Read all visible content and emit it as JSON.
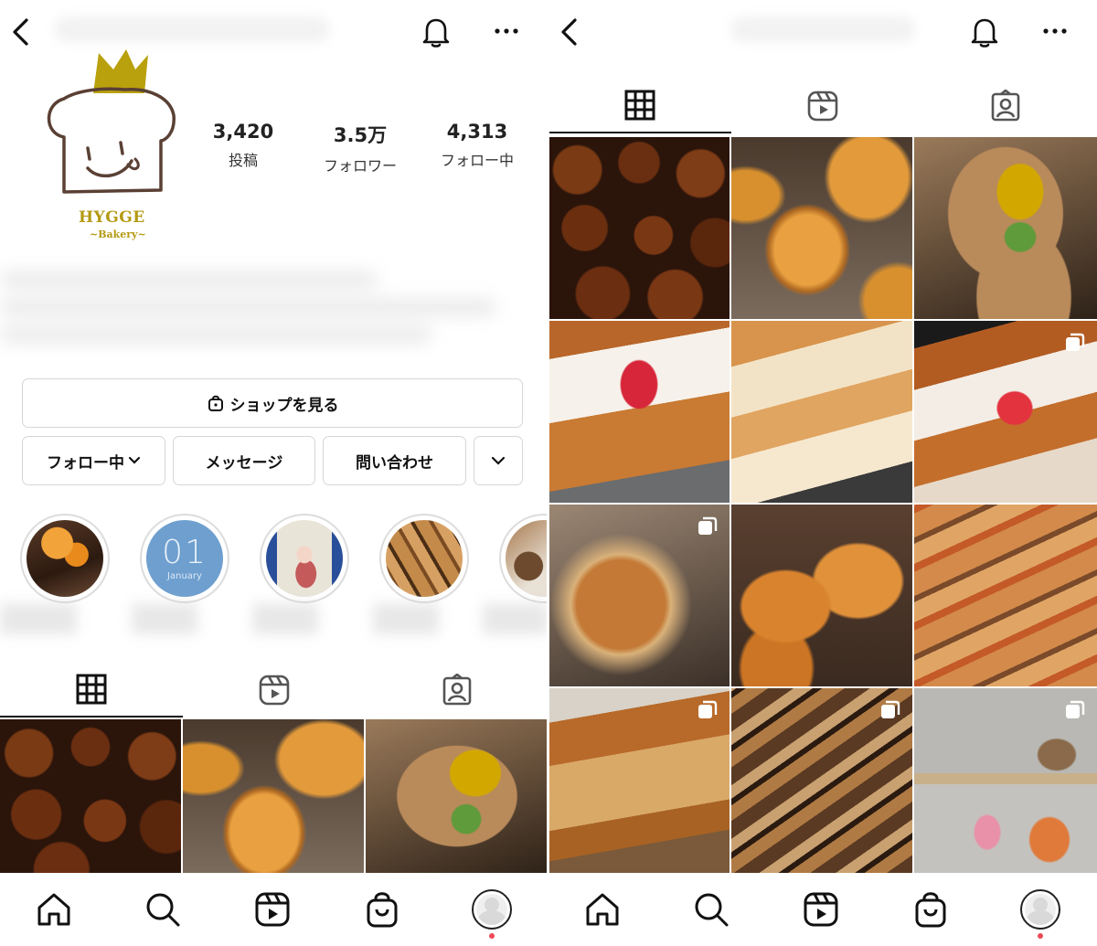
{
  "profile": {
    "logo_title": "HYGGE",
    "logo_subtitle": "~Bakery~",
    "stats": [
      {
        "value": "3,420",
        "label": "投稿"
      },
      {
        "value": "3.5万",
        "label": "フォロワー"
      },
      {
        "value": "4,313",
        "label": "フォロー中"
      }
    ]
  },
  "buttons": {
    "shop": "ショップを見る",
    "following": "フォロー中",
    "message": "メッセージ",
    "contact": "問い合わせ"
  },
  "highlights": [
    {
      "name": "highlight-1"
    },
    {
      "name": "highlight-2",
      "big": "01",
      "small": "January",
      "color": "#6e9fcf"
    },
    {
      "name": "highlight-3"
    },
    {
      "name": "highlight-4"
    },
    {
      "name": "highlight-5"
    }
  ],
  "tabs": [
    "grid-icon",
    "reels-icon",
    "tagged-icon"
  ],
  "nav": [
    "home-icon",
    "search-icon",
    "reels-icon",
    "shop-icon",
    "profile-avatar"
  ],
  "colors": {
    "accent_gold": "#b49a12",
    "notification_dot": "#ed4956",
    "border": "#d6d6d6"
  }
}
